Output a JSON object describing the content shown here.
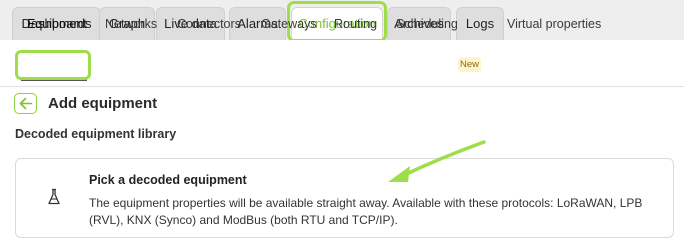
{
  "tabs": [
    {
      "label": "Dashboards"
    },
    {
      "label": "Graph"
    },
    {
      "label": "Live data"
    },
    {
      "label": "Alarms"
    },
    {
      "label": "Configuration"
    },
    {
      "label": "Archives"
    },
    {
      "label": "Logs"
    }
  ],
  "active_tab": "Configuration",
  "subnav": [
    {
      "label": "Equipment"
    },
    {
      "label": "Networks"
    },
    {
      "label": "Connectors"
    },
    {
      "label": "Gateways"
    },
    {
      "label": "Routing"
    },
    {
      "label": "Scheduling"
    },
    {
      "label": "Virtual properties"
    }
  ],
  "active_subnav": "Equipment",
  "scheduling_badge": "New",
  "header": {
    "back_icon": "arrow-left-icon",
    "title": "Add equipment"
  },
  "section": {
    "label": "Decoded equipment library"
  },
  "card": {
    "icon": "equipment-flask-icon",
    "title": "Pick a decoded equipment",
    "description": "The equipment properties will be available straight away. Available with these protocols: LoRaWAN, LPB (RVL), KNX (Synco) and ModBus (both RTU and TCP/IP)."
  },
  "colors": {
    "accent": "#7bc22f",
    "highlight": "#9fdd4a",
    "badge_bg": "#fff4cf",
    "tab_bg": "#dedede"
  }
}
